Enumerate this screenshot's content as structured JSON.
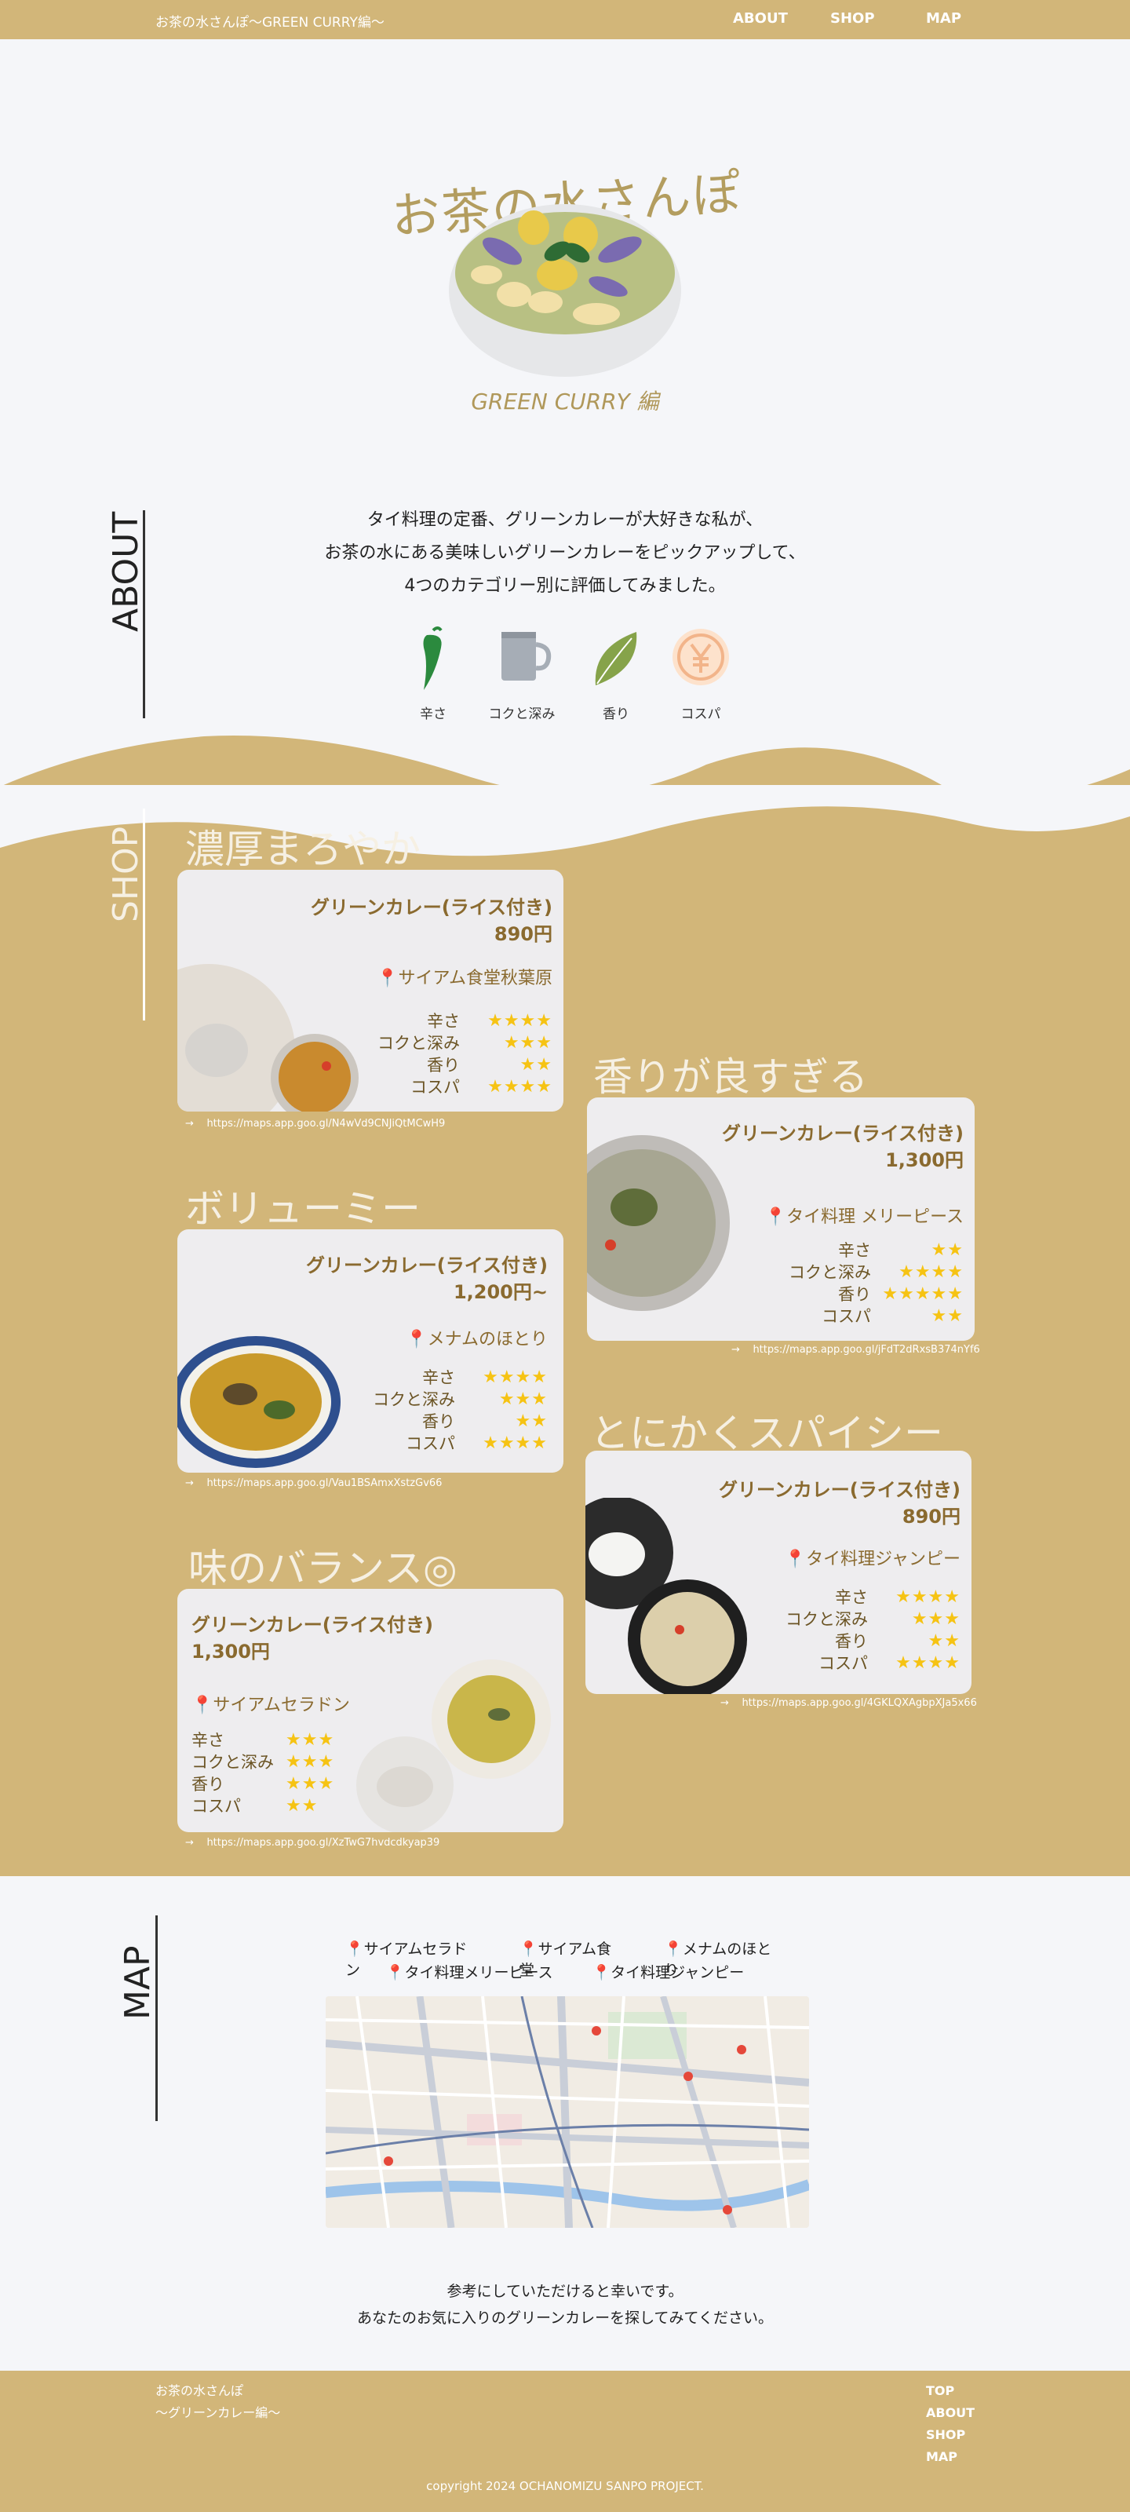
{
  "header": {
    "site_title": "お茶の水さんぽ〜GREEN CURRY編〜",
    "nav": [
      "ABOUT",
      "SHOP",
      "MAP"
    ]
  },
  "hero": {
    "title": "お茶の水さんぽ",
    "subtitle": "GREEN CURRY 編"
  },
  "about": {
    "heading": "ABOUT",
    "lines": [
      "タイ料理の定番、グリーンカレーが大好きな私が、",
      "お茶の水にある美味しいグリーンカレーをピックアップして、",
      "4つのカテゴリー別に評価してみました。"
    ],
    "categories": [
      {
        "label": "辛さ",
        "icon": "chili-icon"
      },
      {
        "label": "コクと深み",
        "icon": "mug-icon"
      },
      {
        "label": "香り",
        "icon": "leaf-icon"
      },
      {
        "label": "コスパ",
        "icon": "yen-icon"
      }
    ]
  },
  "shop": {
    "heading": "SHOP",
    "rating_labels": [
      "辛さ",
      "コクと深み",
      "香り",
      "コスパ"
    ],
    "cards": [
      {
        "title": "濃厚まろやか",
        "dish": "グリーンカレー(ライス付き)",
        "price": "890円",
        "shop": "サイアム食堂秋葉原",
        "stars": [
          4,
          3,
          2,
          4
        ],
        "link": "https://maps.app.goo.gl/N4wVd9CNJiQtMCwH9"
      },
      {
        "title": "香りが良すぎる",
        "dish": "グリーンカレー(ライス付き)",
        "price": "1,300円",
        "shop": "タイ料理 メリーピース",
        "stars": [
          2,
          4,
          5,
          2
        ],
        "link": "https://maps.app.goo.gl/jFdT2dRxsB374nYf6"
      },
      {
        "title": "ボリューミー",
        "dish": "グリーンカレー(ライス付き)",
        "price": "1,200円~",
        "shop": "メナムのほとり",
        "stars": [
          4,
          3,
          2,
          4
        ],
        "link": "https://maps.app.goo.gl/Vau1BSAmxXstzGv66"
      },
      {
        "title": "とにかくスパイシー",
        "dish": "グリーンカレー(ライス付き)",
        "price": "890円",
        "shop": "タイ料理ジャンピー",
        "stars": [
          4,
          3,
          2,
          4
        ],
        "link": "https://maps.app.goo.gl/4GKLQXAgbpXJa5x66"
      },
      {
        "title": "味のバランス◎",
        "dish": "グリーンカレー(ライス付き)",
        "price": "1,300円",
        "shop": "サイアムセラドン",
        "stars": [
          3,
          3,
          3,
          2
        ],
        "link": "https://maps.app.goo.gl/XzTwG7hvdcdkyap39"
      }
    ],
    "link_arrow": "→",
    "pin": "📍",
    "star_char": "★"
  },
  "map": {
    "heading": "MAP",
    "shops_row1": [
      "サイアムセラドン",
      "サイアム食堂",
      "メナムのほとり"
    ],
    "shops_row2": [
      "タイ料理メリーピース",
      "タイ料理ジャンピー"
    ]
  },
  "closing": [
    "参考にしていただけると幸いです。",
    "あなたのお気に入りのグリーンカレーを探してみてください。"
  ],
  "footer": {
    "site_line1": "お茶の水さんぽ",
    "site_line2": "〜グリーンカレー編〜",
    "nav": [
      "TOP",
      "ABOUT",
      "SHOP",
      "MAP"
    ],
    "copyright": "copyright 2024 OCHANOMIZU SANPO PROJECT."
  },
  "colors": {
    "brand_tan": "#d2b679",
    "card_bg": "#eeedef",
    "star": "#f6c313",
    "text_brown": "#8a6a2f"
  }
}
